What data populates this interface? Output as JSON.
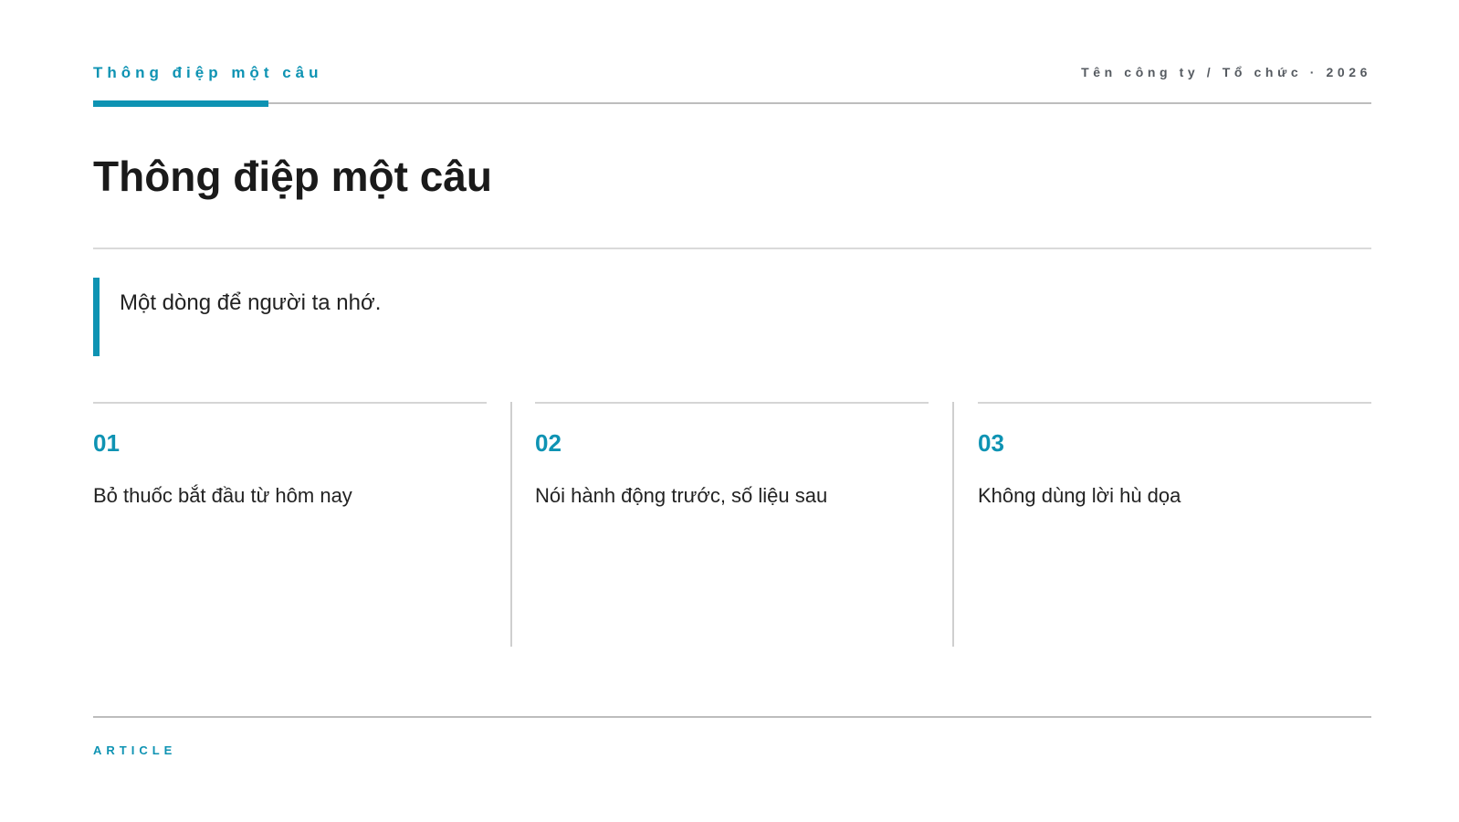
{
  "header": {
    "kicker": "Thông điệp một câu",
    "organization": "Tên công ty / Tổ chức · 2026"
  },
  "title": "Thông điệp một câu",
  "quote": "Một dòng để người ta nhớ.",
  "points": [
    {
      "number": "01",
      "text": "Bỏ thuốc bắt đầu từ hôm nay"
    },
    {
      "number": "02",
      "text": "Nói hành động trước, số liệu sau"
    },
    {
      "number": "03",
      "text": "Không dùng lời hù dọa"
    }
  ],
  "footer": {
    "tag": "ARTICLE"
  },
  "colors": {
    "accent": "#0e93b3",
    "text": "#1a1a1a",
    "muted": "#555a60",
    "rule": "#bdbdbd"
  }
}
